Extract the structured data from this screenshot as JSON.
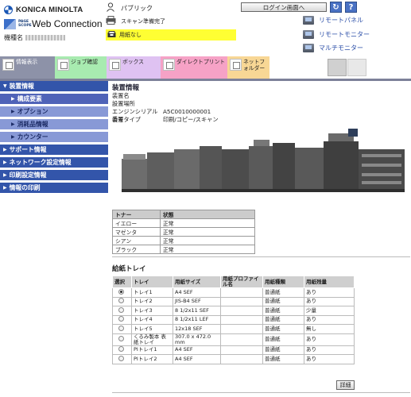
{
  "header": {
    "brand": "KONICA MINOLTA",
    "product_small": "PAGE SCOPE",
    "product": "Web Connection",
    "device_label": "機種名",
    "user": "パブリック",
    "status": "スキャン準備完了",
    "alert": "用紙なし",
    "login_button": "ログイン画面へ",
    "refresh_icon": "refresh-icon",
    "help_label": "?",
    "links": {
      "remote_panel": "リモートパネル",
      "remote_monitor": "リモートモニター",
      "multi_monitor": "マルチモニター"
    },
    "alert_color": "#ffff33"
  },
  "tabs": [
    {
      "label": "情報表示",
      "color": "#8d92a8"
    },
    {
      "label": "ジョブ確認",
      "color": "#a8ebb0"
    },
    {
      "label": "ボックス",
      "color": "#dfc2f2"
    },
    {
      "label": "ダイレクトプリント",
      "color": "#f6a2c6"
    },
    {
      "label": "ネットフォルダー",
      "color": "#f8d795"
    }
  ],
  "sidebar": {
    "items": [
      {
        "label": "装置情報",
        "level": 1
      },
      {
        "label": "構成要素",
        "level": 2
      },
      {
        "label": "オプション",
        "level": 2
      },
      {
        "label": "消耗品情報",
        "level": 2
      },
      {
        "label": "カウンター",
        "level": 2
      },
      {
        "label": "サポート情報",
        "level": 1
      },
      {
        "label": "ネットワーク設定情報",
        "level": 1
      },
      {
        "label": "印刷設定情報",
        "level": 1
      },
      {
        "label": "情報の印刷",
        "level": 1
      }
    ]
  },
  "main": {
    "title": "装置情報",
    "fields": [
      {
        "key": "装置名",
        "value": ""
      },
      {
        "key": "設置場所",
        "value": ""
      },
      {
        "key": "エンジンシリアル番号",
        "value": "A5C0010000001"
      },
      {
        "key": "装置タイプ",
        "value": "印刷/コピー/スキャン"
      }
    ],
    "toner": {
      "headers": [
        "トナー",
        "状態"
      ],
      "rows": [
        [
          "イエロー",
          "正常"
        ],
        [
          "マゼンタ",
          "正常"
        ],
        [
          "シアン",
          "正常"
        ],
        [
          "ブラック",
          "正常"
        ]
      ]
    },
    "tray_title": "給紙トレイ",
    "trays": {
      "headers": [
        "選択",
        "トレイ",
        "用紙サイズ",
        "用紙プロファイル名",
        "用紙種類",
        "用紙残量"
      ],
      "rows": [
        {
          "tray": "トレイ1",
          "size": "A4 SEF",
          "profile": "",
          "type": "普通紙",
          "level": "あり",
          "selected": true
        },
        {
          "tray": "トレイ2",
          "size": "JIS-B4 SEF",
          "profile": "",
          "type": "普通紙",
          "level": "あり",
          "selected": false
        },
        {
          "tray": "トレイ3",
          "size": "8 1/2x11 SEF",
          "profile": "",
          "type": "普通紙",
          "level": "少量",
          "selected": false
        },
        {
          "tray": "トレイ4",
          "size": "8 1/2x11 LEF",
          "profile": "",
          "type": "普通紙",
          "level": "あり",
          "selected": false
        },
        {
          "tray": "トレイ5",
          "size": "12x18 SEF",
          "profile": "",
          "type": "普通紙",
          "level": "無し",
          "selected": false
        },
        {
          "tray": "くるみ製本 表紙トレイ",
          "size": "307.0 x 472.0 mm",
          "profile": "",
          "type": "普通紙",
          "level": "あり",
          "selected": false
        },
        {
          "tray": "PIトレイ1",
          "size": "A4 SEF",
          "profile": "",
          "type": "普通紙",
          "level": "あり",
          "selected": false
        },
        {
          "tray": "PIトレイ2",
          "size": "A4 SEF",
          "profile": "",
          "type": "普通紙",
          "level": "あり",
          "selected": false
        }
      ]
    },
    "detail_button": "詳細"
  }
}
